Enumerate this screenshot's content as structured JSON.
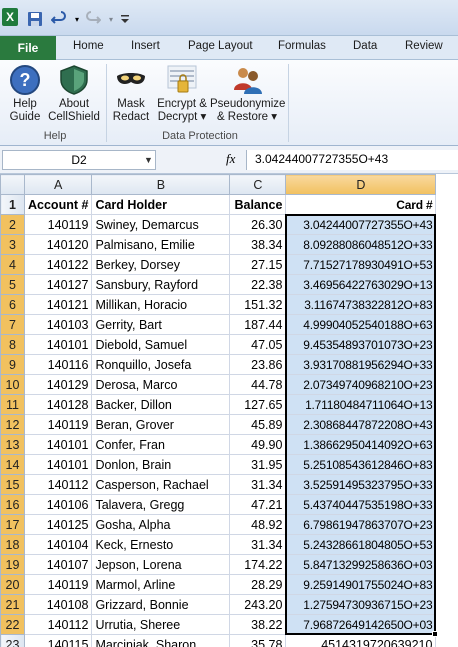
{
  "app_icon": {
    "label": "X"
  },
  "ribbon_tabs": [
    {
      "label": "File"
    },
    {
      "label": "Home"
    },
    {
      "label": "Insert"
    },
    {
      "label": "Page Layout"
    },
    {
      "label": "Formulas"
    },
    {
      "label": "Data"
    },
    {
      "label": "Review"
    }
  ],
  "ribbon": {
    "help_guide": "Help\nGuide",
    "about_cellshield": "About\nCellShield",
    "mask_redact": "Mask\nRedact",
    "encrypt_decrypt": "Encrypt &\nDecrypt ▾",
    "pseudonymize": "Pseudonymize\n& Restore ▾",
    "group_help": "Help",
    "group_data_protection": "Data Protection"
  },
  "formula_bar": {
    "name_box": "D2",
    "fx": "fx",
    "formula": "3.04244007727355O+43"
  },
  "columns": [
    "A",
    "B",
    "C",
    "D"
  ],
  "header_row": {
    "row": "1",
    "a": "Account #",
    "b": "Card Holder",
    "c": "Balance",
    "d": "Card #"
  },
  "rows": [
    {
      "row": "2",
      "a": "140119",
      "b": "Swiney, Demarcus",
      "c": "26.30",
      "d": "3.04244007727355O+43"
    },
    {
      "row": "3",
      "a": "140120",
      "b": "Palmisano, Emilie",
      "c": "38.34",
      "d": "8.09288086048512O+33"
    },
    {
      "row": "4",
      "a": "140122",
      "b": "Berkey, Dorsey",
      "c": "27.15",
      "d": "7.71527178930491O+53"
    },
    {
      "row": "5",
      "a": "140127",
      "b": "Sansbury, Rayford",
      "c": "22.38",
      "d": "3.46956422763029O+13"
    },
    {
      "row": "6",
      "a": "140121",
      "b": "Millikan, Horacio",
      "c": "151.32",
      "d": "3.11674738322812O+83"
    },
    {
      "row": "7",
      "a": "140103",
      "b": "Gerrity, Bart",
      "c": "187.44",
      "d": "4.99904052540188O+63"
    },
    {
      "row": "8",
      "a": "140101",
      "b": "Diebold, Samuel",
      "c": "47.05",
      "d": "9.45354893701073O+23"
    },
    {
      "row": "9",
      "a": "140116",
      "b": "Ronquillo, Josefa",
      "c": "23.86",
      "d": "3.93170881956294O+33"
    },
    {
      "row": "10",
      "a": "140129",
      "b": "Derosa, Marco",
      "c": "44.78",
      "d": "2.07349740968210O+23"
    },
    {
      "row": "11",
      "a": "140128",
      "b": "Backer, Dillon",
      "c": "127.65",
      "d": "1.71180484711064O+13"
    },
    {
      "row": "12",
      "a": "140119",
      "b": "Beran, Grover",
      "c": "45.89",
      "d": "2.30868447872208O+43"
    },
    {
      "row": "13",
      "a": "140101",
      "b": "Confer, Fran",
      "c": "49.90",
      "d": "1.38662950414092O+63"
    },
    {
      "row": "14",
      "a": "140101",
      "b": "Donlon, Brain",
      "c": "31.95",
      "d": "5.25108543612846O+83"
    },
    {
      "row": "15",
      "a": "140112",
      "b": "Casperson, Rachael",
      "c": "31.34",
      "d": "3.52591495323795O+33"
    },
    {
      "row": "16",
      "a": "140106",
      "b": "Talavera, Gregg",
      "c": "47.21",
      "d": "5.43740447535198O+33"
    },
    {
      "row": "17",
      "a": "140125",
      "b": "Gosha, Alpha",
      "c": "48.92",
      "d": "6.79861947863707O+23"
    },
    {
      "row": "18",
      "a": "140104",
      "b": "Keck, Ernesto",
      "c": "31.34",
      "d": "5.24328661804805O+53"
    },
    {
      "row": "19",
      "a": "140107",
      "b": "Jepson, Lorena",
      "c": "174.22",
      "d": "5.84713299258636O+03"
    },
    {
      "row": "20",
      "a": "140119",
      "b": "Marmol, Arline",
      "c": "28.29",
      "d": "9.25914901755024O+83"
    },
    {
      "row": "21",
      "a": "140108",
      "b": "Grizzard, Bonnie",
      "c": "243.20",
      "d": "1.27594730936715O+23"
    },
    {
      "row": "22",
      "a": "140112",
      "b": "Urrutia, Sheree",
      "c": "38.22",
      "d": "7.96872649142650O+03"
    },
    {
      "row": "23",
      "a": "140115",
      "b": "Marciniak, Sharon",
      "c": "35.78",
      "d": "4514319720639210"
    }
  ],
  "colors": {
    "file_tab": "#2a7a3e",
    "selection_fill": "#cfe1f4",
    "selected_header": "#f1c05f"
  }
}
